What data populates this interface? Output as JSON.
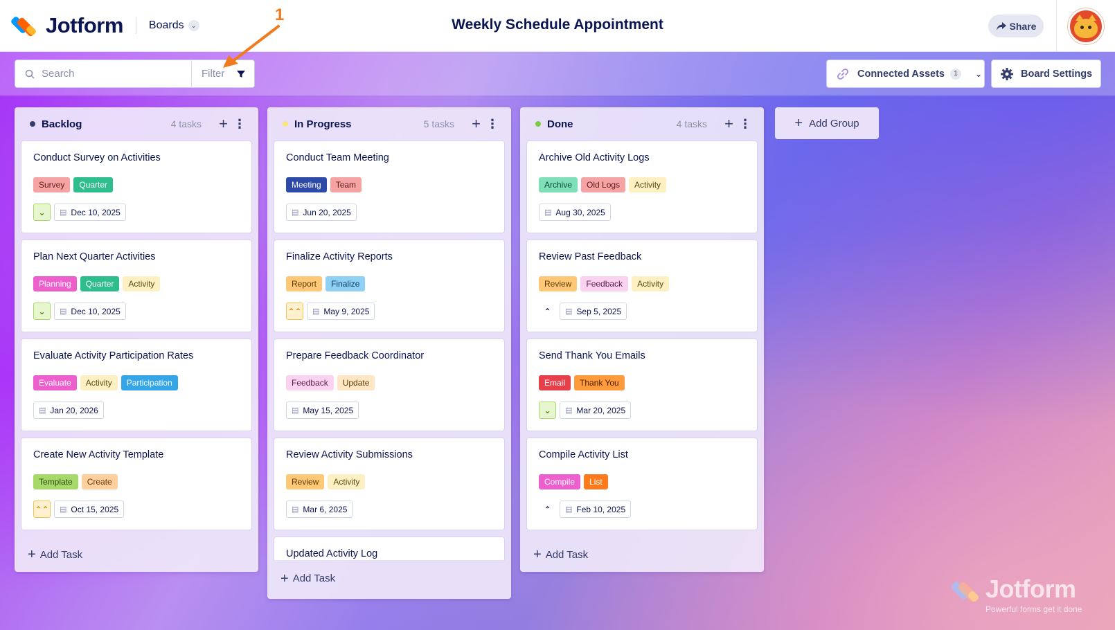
{
  "header": {
    "logo_text": "Jotform",
    "boards_label": "Boards",
    "title": "Weekly Schedule Appointment",
    "share_label": "Share"
  },
  "toolbar": {
    "search_placeholder": "Search",
    "filter_label": "Filter",
    "annotation_number": "1",
    "connected_assets_label": "Connected Assets",
    "connected_assets_count": "1",
    "board_settings_label": "Board Settings"
  },
  "columns": [
    {
      "title": "Backlog",
      "count": "4 tasks",
      "dot_color": "#343c6a",
      "add_task_label": "Add Task",
      "cards": [
        {
          "title": "Conduct Survey on Activities",
          "tags": [
            {
              "label": "Survey",
              "bg": "#f5a3a3",
              "fg": "#5a1a1a"
            },
            {
              "label": "Quarter",
              "bg": "#2ebd8c",
              "fg": "#ffffff"
            }
          ],
          "priority": "low",
          "date": "Dec 10, 2025"
        },
        {
          "title": "Plan Next Quarter Activities",
          "tags": [
            {
              "label": "Planning",
              "bg": "#ec5fcd",
              "fg": "#ffffff"
            },
            {
              "label": "Quarter",
              "bg": "#2ebd8c",
              "fg": "#ffffff"
            },
            {
              "label": "Activity",
              "bg": "#fdf1c4",
              "fg": "#5a4a10"
            }
          ],
          "priority": "low",
          "date": "Dec 10, 2025"
        },
        {
          "title": "Evaluate Activity Participation Rates",
          "tags": [
            {
              "label": "Evaluate",
              "bg": "#ec5fcd",
              "fg": "#ffffff"
            },
            {
              "label": "Activity",
              "bg": "#fdf1c4",
              "fg": "#5a4a10"
            },
            {
              "label": "Participation",
              "bg": "#34a6e8",
              "fg": "#ffffff"
            }
          ],
          "priority": "none",
          "date": "Jan 20, 2026"
        },
        {
          "title": "Create New Activity Template",
          "tags": [
            {
              "label": "Template",
              "bg": "#a6d96a",
              "fg": "#2f4a10"
            },
            {
              "label": "Create",
              "bg": "#ffcf9e",
              "fg": "#6a3a00"
            }
          ],
          "priority": "high",
          "date": "Oct 15, 2025"
        }
      ]
    },
    {
      "title": "In Progress",
      "count": "5 tasks",
      "dot_color": "#f7e57a",
      "add_task_label": "Add Task",
      "cards": [
        {
          "title": "Conduct Team Meeting",
          "tags": [
            {
              "label": "Meeting",
              "bg": "#2d4aa8",
              "fg": "#ffffff"
            },
            {
              "label": "Team",
              "bg": "#f5a3a3",
              "fg": "#5a1a1a"
            }
          ],
          "priority": "none",
          "date": "Jun 20, 2025"
        },
        {
          "title": "Finalize Activity Reports",
          "tags": [
            {
              "label": "Report",
              "bg": "#ffc877",
              "fg": "#5a3a00"
            },
            {
              "label": "Finalize",
              "bg": "#8fd0f5",
              "fg": "#0a3a5a"
            }
          ],
          "priority": "high",
          "date": "May 9, 2025"
        },
        {
          "title": "Prepare Feedback Coordinator",
          "tags": [
            {
              "label": "Feedback",
              "bg": "#fbd3f0",
              "fg": "#5a1a4a"
            },
            {
              "label": "Update",
              "bg": "#ffe6c4",
              "fg": "#5a3a00"
            }
          ],
          "priority": "none",
          "date": "May 15, 2025"
        },
        {
          "title": "Review Activity Submissions",
          "tags": [
            {
              "label": "Review",
              "bg": "#ffc877",
              "fg": "#5a3a00"
            },
            {
              "label": "Activity",
              "bg": "#fdf1c4",
              "fg": "#5a4a10"
            }
          ],
          "priority": "none",
          "date": "Mar 6, 2025"
        },
        {
          "title": "Updated Activity Log",
          "tags": [],
          "priority": "none",
          "date": ""
        }
      ]
    },
    {
      "title": "Done",
      "count": "4 tasks",
      "dot_color": "#7bcf3f",
      "add_task_label": "Add Task",
      "cards": [
        {
          "title": "Archive Old Activity Logs",
          "tags": [
            {
              "label": "Archive",
              "bg": "#7fe0b8",
              "fg": "#0a4a30"
            },
            {
              "label": "Old Logs",
              "bg": "#f5a3a3",
              "fg": "#5a1a1a"
            },
            {
              "label": "Activity",
              "bg": "#fdf1c4",
              "fg": "#5a4a10"
            }
          ],
          "priority": "none",
          "date": "Aug 30, 2025"
        },
        {
          "title": "Review Past Feedback",
          "tags": [
            {
              "label": "Review",
              "bg": "#ffc877",
              "fg": "#5a3a00"
            },
            {
              "label": "Feedback",
              "bg": "#fbd3f0",
              "fg": "#5a1a4a"
            },
            {
              "label": "Activity",
              "bg": "#fdf1c4",
              "fg": "#5a4a10"
            }
          ],
          "priority": "medium",
          "date": "Sep 5, 2025"
        },
        {
          "title": "Send Thank You Emails",
          "tags": [
            {
              "label": "Email",
              "bg": "#e8404a",
              "fg": "#ffffff"
            },
            {
              "label": "Thank You",
              "bg": "#ff9a3d",
              "fg": "#4a2000"
            }
          ],
          "priority": "low",
          "date": "Mar 20, 2025"
        },
        {
          "title": "Compile Activity List",
          "tags": [
            {
              "label": "Compile",
              "bg": "#ec5fcd",
              "fg": "#ffffff"
            },
            {
              "label": "List",
              "bg": "#ff7a1a",
              "fg": "#ffffff"
            }
          ],
          "priority": "medium",
          "date": "Feb 10, 2025"
        }
      ]
    }
  ],
  "add_group_label": "Add Group",
  "watermark": {
    "text": "Jotform",
    "subtitle": "Powerful forms get it done"
  }
}
